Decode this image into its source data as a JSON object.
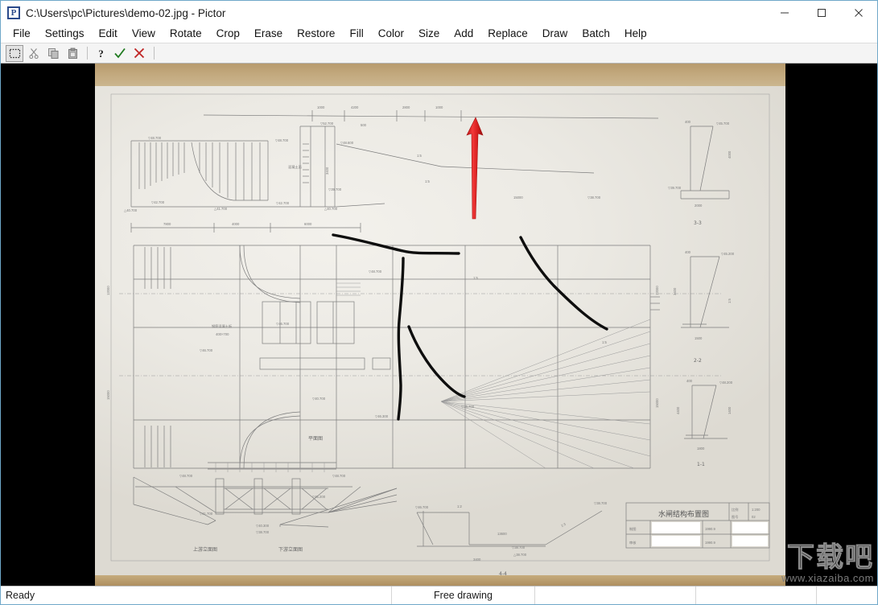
{
  "window": {
    "title": "C:\\Users\\pc\\Pictures\\demo-02.jpg - Pictor",
    "app_name": "Pictor",
    "app_icon_letter": "P",
    "file_path": "C:\\Users\\pc\\Pictures\\demo-02.jpg",
    "controls": {
      "minimize": "minimize-button",
      "maximize": "maximize-button",
      "close": "close-button"
    },
    "border_color": "#6fa8c9"
  },
  "menu": {
    "items": [
      {
        "label": "File"
      },
      {
        "label": "Settings"
      },
      {
        "label": "Edit"
      },
      {
        "label": "View"
      },
      {
        "label": "Rotate"
      },
      {
        "label": "Crop"
      },
      {
        "label": "Erase"
      },
      {
        "label": "Restore"
      },
      {
        "label": "Fill"
      },
      {
        "label": "Color"
      },
      {
        "label": "Size"
      },
      {
        "label": "Add"
      },
      {
        "label": "Replace"
      },
      {
        "label": "Draw"
      },
      {
        "label": "Batch"
      },
      {
        "label": "Help"
      }
    ],
    "highlighted": "Draw"
  },
  "toolbar": {
    "buttons": [
      {
        "name": "select-region-icon",
        "tooltip": "Select",
        "selected": true
      },
      {
        "name": "cut-icon",
        "tooltip": "Cut",
        "selected": false
      },
      {
        "name": "copy-icon",
        "tooltip": "Copy",
        "selected": false
      },
      {
        "name": "paste-icon",
        "tooltip": "Paste",
        "selected": false
      },
      {
        "name": "help-icon",
        "tooltip": "Help",
        "selected": false
      },
      {
        "name": "confirm-check-icon",
        "tooltip": "Apply",
        "selected": false
      },
      {
        "name": "cancel-cross-icon",
        "tooltip": "Cancel",
        "selected": false
      }
    ],
    "accent_confirm": "#1f7a1f",
    "accent_cancel": "#c02626"
  },
  "canvas": {
    "background": "#000000",
    "image_name": "demo-02.jpg",
    "image_description": "Photograph of a hand-drafted engineering blueprint of a sluice-gate structure, with black free-hand pen strokes drawn on top by the user.",
    "blueprint": {
      "title_block": {
        "title": "水闸结构布置图",
        "scale_label": "比例",
        "scale_value": "1:200",
        "sheet_label": "图号",
        "sheet_value": "02",
        "rows": [
          {
            "label": "制图",
            "date": "1990.9"
          },
          {
            "label": "审核",
            "date": "1990.9"
          }
        ]
      },
      "view_labels": [
        "平面图",
        "上游立面图",
        "下游立面图",
        "4-4",
        "3-3",
        "2-2",
        "1-1"
      ],
      "elevation_callouts": [
        "▽48.700",
        "▽46.700",
        "▽42.700",
        "▽41.700",
        "▽38.700",
        "▽39.700",
        "▽45.200",
        "▽40.300",
        "△40.700",
        "△38.700"
      ],
      "dimension_values": [
        "1000",
        "4200",
        "2800",
        "1000",
        "500",
        "7800",
        "4000",
        "6000",
        "3400",
        "15000",
        "12000",
        "2400",
        "13000",
        "1500",
        "800",
        "400"
      ],
      "slope_labels": [
        "1:5",
        "1:2",
        "1:3"
      ]
    },
    "freehand_strokes": 4,
    "stroke_color": "#111111",
    "annotation": {
      "type": "arrow",
      "color": "#e02020",
      "points_to": "Draw"
    }
  },
  "watermark": {
    "logo_text": "下载吧",
    "url": "www.xiazaiba.com"
  },
  "status_bar": {
    "message": "Ready",
    "mode": "Free drawing",
    "cell3": "",
    "cell4": "",
    "cell5": ""
  }
}
